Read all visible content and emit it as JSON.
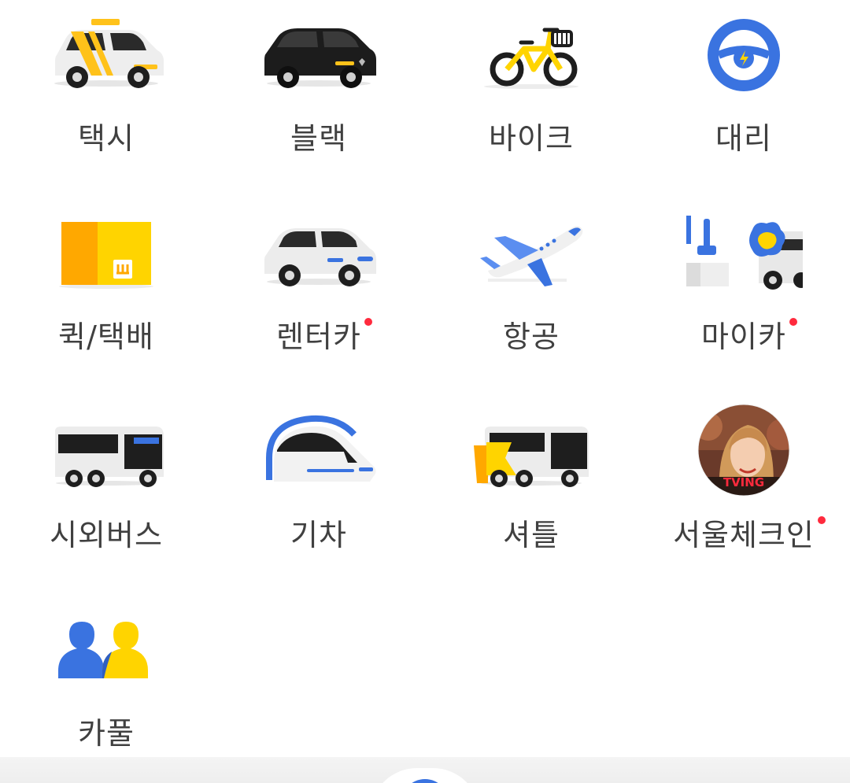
{
  "colors": {
    "label": "#404040",
    "new_dot": "#ff2a3d",
    "kakao_yellow": "#ffd400",
    "kakao_blue": "#3a73e0"
  },
  "services": [
    {
      "id": "taxi",
      "label": "택시",
      "icon": "taxi-car-icon",
      "new": false
    },
    {
      "id": "black",
      "label": "블랙",
      "icon": "black-car-icon",
      "new": false
    },
    {
      "id": "bike",
      "label": "바이크",
      "icon": "bike-icon",
      "new": false
    },
    {
      "id": "driver",
      "label": "대리",
      "icon": "steering-wheel-icon",
      "new": false
    },
    {
      "id": "quick",
      "label": "퀵/택배",
      "icon": "parcel-box-icon",
      "new": false
    },
    {
      "id": "rentcar",
      "label": "렌터카",
      "icon": "rental-car-icon",
      "new": true
    },
    {
      "id": "flight",
      "label": "항공",
      "icon": "airplane-icon",
      "new": false
    },
    {
      "id": "mycar",
      "label": "마이카",
      "icon": "car-care-icon",
      "new": true
    },
    {
      "id": "bus",
      "label": "시외버스",
      "icon": "bus-icon",
      "new": false
    },
    {
      "id": "train",
      "label": "기차",
      "icon": "train-icon",
      "new": false
    },
    {
      "id": "shuttle",
      "label": "셔틀",
      "icon": "shuttle-icon",
      "new": false
    },
    {
      "id": "seoulcheckin",
      "label": "서울체크인",
      "icon": "promo-avatar-icon",
      "new": true,
      "badge_text": "TVING"
    },
    {
      "id": "carpool",
      "label": "카풀",
      "icon": "people-icon",
      "new": false
    }
  ]
}
